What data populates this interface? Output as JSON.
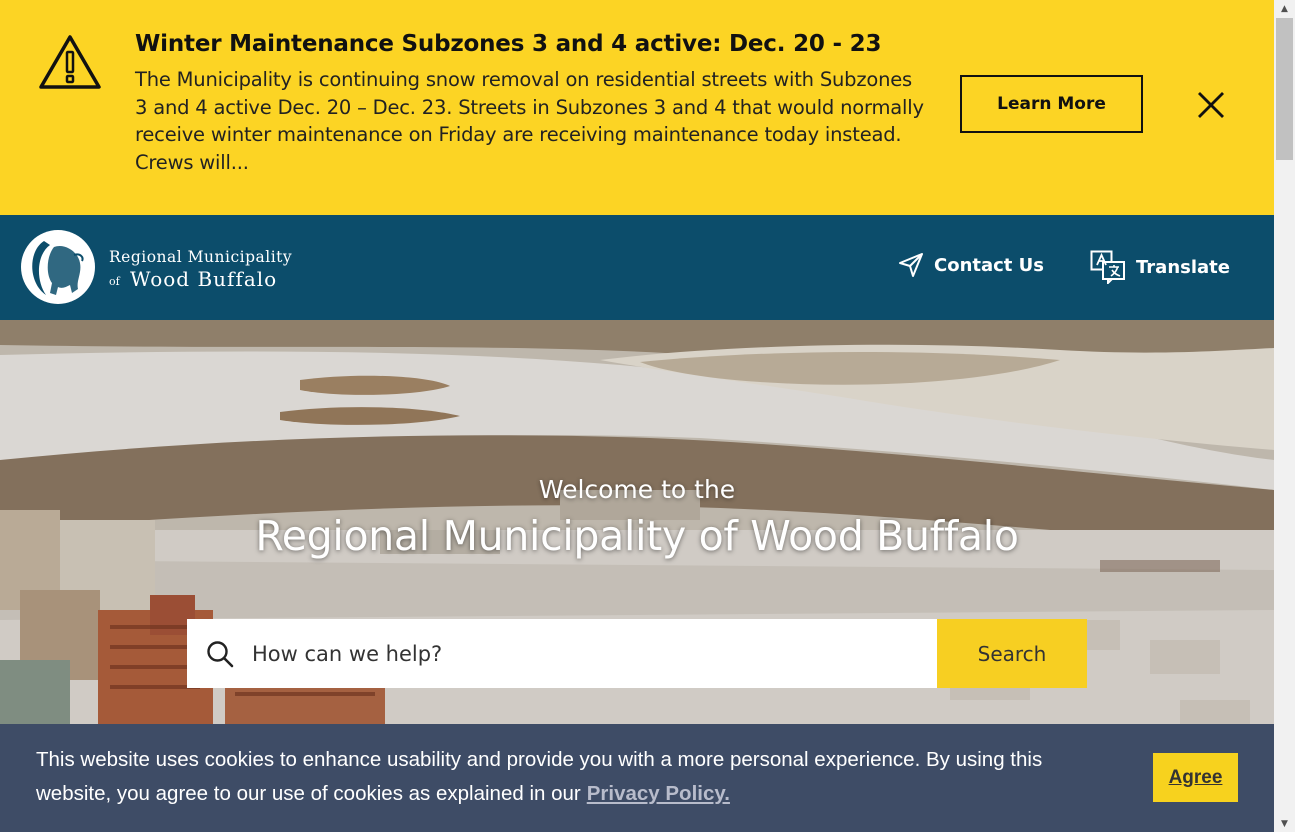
{
  "alert": {
    "icon": "warning-icon",
    "title": "Winter Maintenance Subzones 3 and 4 active: Dec. 20 - 23",
    "body": "The Municipality is continuing snow removal on residential streets with Subzones 3 and 4 active Dec. 20 – Dec. 23. Streets in Subzones 3 and 4 that would normally receive winter maintenance on Friday are receiving maintenance today instead. Crews will...",
    "button_label": "Learn More",
    "close_icon": "close-icon",
    "background": "#fcd424"
  },
  "header": {
    "logo": {
      "line1": "Regional Municipality",
      "of": "of",
      "line2": "Wood Buffalo"
    },
    "nav": {
      "contact": "Contact Us",
      "translate": "Translate"
    },
    "background": "#0c4d6b"
  },
  "hero": {
    "welcome": "Welcome to the",
    "title": "Regional Municipality of Wood Buffalo",
    "search": {
      "placeholder": "How can we help?",
      "button_label": "Search"
    }
  },
  "cookie": {
    "text": "This website uses cookies to enhance usability and provide you with a more personal experience. By using this website, you agree to our use of cookies as explained in our",
    "link": "Privacy Policy.",
    "button_label": "Agree",
    "background": "#3e4c66"
  }
}
